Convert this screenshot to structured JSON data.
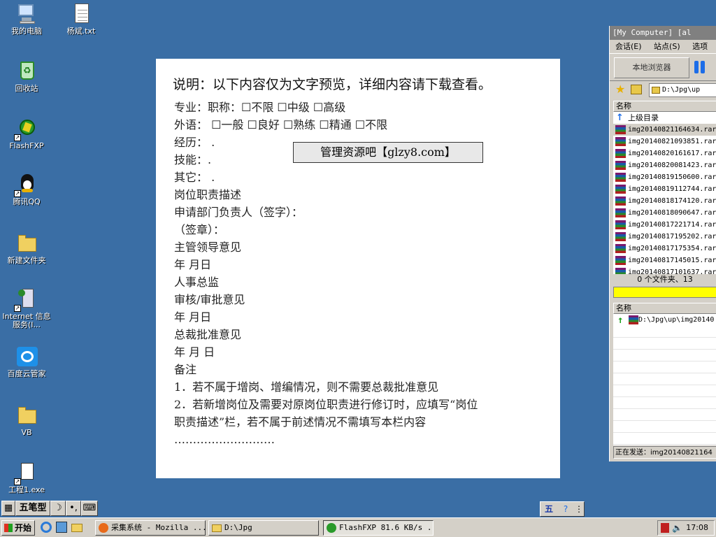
{
  "desktop": {
    "icons": [
      {
        "label": "我的电脑"
      },
      {
        "label": "杨斌.txt"
      },
      {
        "label": "回收站"
      },
      {
        "label": "FlashFXP"
      },
      {
        "label": "腾讯QQ"
      },
      {
        "label": "新建文件夹"
      },
      {
        "label": "Internet 信息服务(I..."
      },
      {
        "label": "百度云管家"
      },
      {
        "label": "VB"
      },
      {
        "label": "工程1.exe"
      }
    ]
  },
  "document": {
    "headline": "说明：以下内容仅为文字预览，详细内容请下载查看。",
    "watermark": "管理资源吧【glzy8.com】",
    "lines": [
      "专业：职称：☐不限 ☐中级 ☐高级",
      "外语： ☐一般 ☐良好 ☐熟练 ☐精通 ☐不限",
      "经历：  .",
      "技能：.",
      "其它：  .",
      "岗位职责描述",
      "申请部门负责人（签字）：",
      "（签章）：",
      "主管领导意见",
      "年 月日",
      "人事总监",
      "审核/审批意见",
      "年 月日",
      "总裁批准意见",
      "年 月 日",
      "备注",
      "1．若不属于增岗、增编情况，则不需要总裁批准意见",
      "2．若新增岗位及需要对原岗位职责进行修订时，应填写“岗位",
      "职责描述”栏，若不属于前述情况不需填写本栏内容",
      "………………………"
    ]
  },
  "flashfxp": {
    "title": "[My Computer]  [al",
    "menu": [
      "会话(E)",
      "站点(S)",
      "选项"
    ],
    "local_browser_button": "本地浏览器",
    "path": "D:\\Jpg\\up",
    "list_header": "名称",
    "parent_dir": "上级目录",
    "files": [
      "img20140821164634.rar",
      "img20140821093851.rar",
      "img20140820161617.rar",
      "img20140820081423.rar",
      "img20140819150600.rar",
      "img20140819112744.rar",
      "img20140818174120.rar",
      "img20140818090647.rar",
      "img20140817221714.rar",
      "img20140817195202.rar",
      "img20140817175354.rar",
      "img20140817145015.rar",
      "img20140817101637.rar"
    ],
    "status": "0 个文件夹、13",
    "queue_header": "名称",
    "queue_item": "D:\\Jpg\\up\\img20140",
    "sending_status": "正在发送：img20140821164"
  },
  "ime": {
    "mode": "五笔型",
    "moon": "☽",
    "punct": "•,"
  },
  "taskbar": {
    "start_label": "开始",
    "tasks": [
      {
        "label": "采集系统 - Mozilla ..."
      },
      {
        "label": "D:\\Jpg"
      },
      {
        "label": "FlashFXP 81.6 KB/s ..."
      }
    ],
    "clock": "17:08"
  },
  "colors": {
    "desktop": "#3a6ea5",
    "progress": "#ffff00"
  }
}
